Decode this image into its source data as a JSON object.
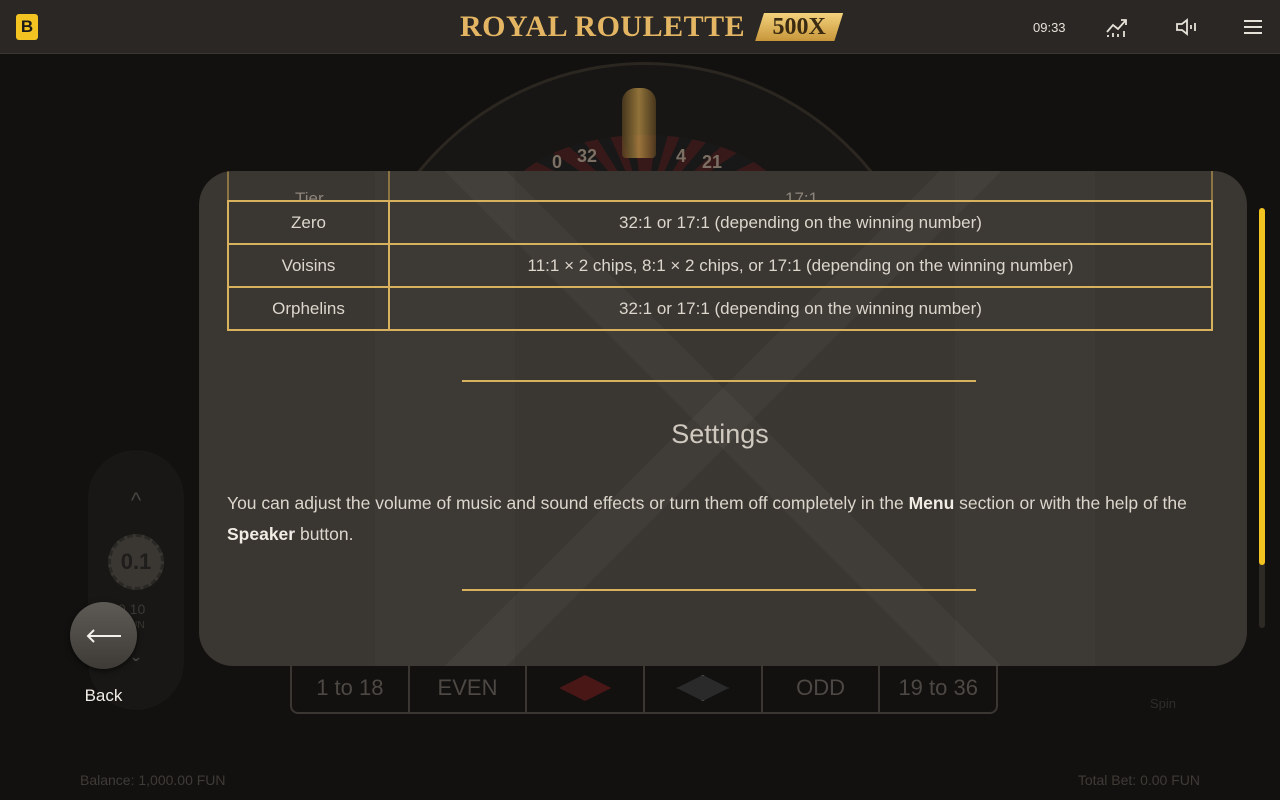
{
  "header": {
    "brand_letter": "B",
    "logo_title": "ROYAL ROULETTE",
    "logo_badge": "500X",
    "clock": "09:33",
    "icons": [
      "statistics-icon",
      "sound-icon",
      "menu-icon"
    ]
  },
  "game": {
    "wheel_numbers": [
      "32",
      "4",
      "21",
      "0"
    ],
    "bets": [
      "1 to 18",
      "EVEN",
      "ODD",
      "19 to 36"
    ],
    "chip_value": "0.1",
    "chip_amount": "0.10",
    "chip_unit": "FUN",
    "balance": "Balance: 1,000.00 FUN",
    "total_bet": "Total Bet: 0.00 FUN",
    "spin_label": "Spin"
  },
  "rules": {
    "clipped_row": {
      "name": "Tier",
      "payout": "17:1"
    },
    "payout_rows": [
      {
        "name": "Zero",
        "payout": "32:1 or 17:1 (depending on the winning number)"
      },
      {
        "name": "Voisins",
        "payout": "11:1 × 2 chips, 8:1 × 2 chips, or 17:1 (depending on the winning number)"
      },
      {
        "name": "Orphelins",
        "payout": "32:1 or 17:1 (depending on the winning number)"
      }
    ],
    "settings_title": "Settings",
    "settings_text_1": "You can adjust the volume of music and sound effects or turn them off completely in the ",
    "settings_bold_1": "Menu",
    "settings_text_2": " section or with the help of the ",
    "settings_bold_2": "Speaker",
    "settings_text_3": " button.",
    "scroll_fraction": 0.85
  },
  "back": {
    "label": "Back"
  },
  "colors": {
    "accent": "#f2c321",
    "gold_border": "#d8b15e",
    "panel": "#3a3631",
    "background": "#121110"
  }
}
